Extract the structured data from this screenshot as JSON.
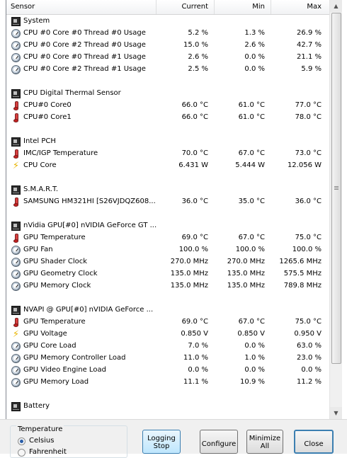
{
  "header": {
    "sensor": "Sensor",
    "current": "Current",
    "min": "Min",
    "max": "Max"
  },
  "rows": [
    {
      "type": "group",
      "icon": "board",
      "name": "System"
    },
    {
      "type": "item",
      "icon": "gauge",
      "name": "CPU #0 Core #0 Thread #0 Usage",
      "cur": "5.2 %",
      "min": "1.3 %",
      "max": "26.9 %"
    },
    {
      "type": "item",
      "icon": "gauge",
      "name": "CPU #0 Core #2 Thread #0 Usage",
      "cur": "15.0 %",
      "min": "2.6 %",
      "max": "42.7 %"
    },
    {
      "type": "item",
      "icon": "gauge",
      "name": "CPU #0 Core #0 Thread #1 Usage",
      "cur": "2.6 %",
      "min": "0.0 %",
      "max": "21.1 %"
    },
    {
      "type": "item",
      "icon": "gauge",
      "name": "CPU #0 Core #2 Thread #1 Usage",
      "cur": "2.5 %",
      "min": "0.0 %",
      "max": "5.9 %"
    },
    {
      "type": "blank"
    },
    {
      "type": "group",
      "icon": "board",
      "name": "CPU Digital Thermal Sensor"
    },
    {
      "type": "item",
      "icon": "therm",
      "name": "CPU#0 Core0",
      "cur": "66.0 °C",
      "min": "61.0 °C",
      "max": "77.0 °C"
    },
    {
      "type": "item",
      "icon": "therm",
      "name": "CPU#0 Core1",
      "cur": "66.0 °C",
      "min": "61.0 °C",
      "max": "78.0 °C"
    },
    {
      "type": "blank"
    },
    {
      "type": "group",
      "icon": "board",
      "name": "Intel PCH"
    },
    {
      "type": "item",
      "icon": "therm",
      "name": "IMC/IGP Temperature",
      "cur": "70.0 °C",
      "min": "67.0 °C",
      "max": "73.0 °C"
    },
    {
      "type": "item",
      "icon": "bolt",
      "name": "CPU Core",
      "cur": "6.431 W",
      "min": "5.444 W",
      "max": "12.056 W"
    },
    {
      "type": "blank"
    },
    {
      "type": "group",
      "icon": "board",
      "name": "S.M.A.R.T."
    },
    {
      "type": "item",
      "icon": "therm",
      "name": "SAMSUNG HM321HI [S26VJDQZ608...",
      "cur": "36.0 °C",
      "min": "35.0 °C",
      "max": "36.0 °C"
    },
    {
      "type": "blank"
    },
    {
      "type": "group",
      "icon": "board",
      "name": "nVidia GPU[#0] nVIDIA GeForce GT ..."
    },
    {
      "type": "item",
      "icon": "therm",
      "name": "GPU Temperature",
      "cur": "69.0 °C",
      "min": "67.0 °C",
      "max": "75.0 °C"
    },
    {
      "type": "item",
      "icon": "gauge",
      "name": "GPU Fan",
      "cur": "100.0 %",
      "min": "100.0 %",
      "max": "100.0 %"
    },
    {
      "type": "item",
      "icon": "gauge",
      "name": "GPU Shader Clock",
      "cur": "270.0 MHz",
      "min": "270.0 MHz",
      "max": "1265.6 MHz"
    },
    {
      "type": "item",
      "icon": "gauge",
      "name": "GPU Geometry Clock",
      "cur": "135.0 MHz",
      "min": "135.0 MHz",
      "max": "575.5 MHz"
    },
    {
      "type": "item",
      "icon": "gauge",
      "name": "GPU Memory Clock",
      "cur": "135.0 MHz",
      "min": "135.0 MHz",
      "max": "789.8 MHz"
    },
    {
      "type": "blank"
    },
    {
      "type": "group",
      "icon": "board",
      "name": "NVAPI @ GPU[#0] nVIDIA GeForce ..."
    },
    {
      "type": "item",
      "icon": "therm",
      "name": "GPU Temperature",
      "cur": "69.0 °C",
      "min": "67.0 °C",
      "max": "75.0 °C"
    },
    {
      "type": "item",
      "icon": "bolt",
      "name": "GPU Voltage",
      "cur": "0.850 V",
      "min": "0.850 V",
      "max": "0.950 V"
    },
    {
      "type": "item",
      "icon": "gauge",
      "name": "GPU Core Load",
      "cur": "7.0 %",
      "min": "0.0 %",
      "max": "63.0 %"
    },
    {
      "type": "item",
      "icon": "gauge",
      "name": "GPU Memory Controller Load",
      "cur": "11.0 %",
      "min": "1.0 %",
      "max": "23.0 %"
    },
    {
      "type": "item",
      "icon": "gauge",
      "name": "GPU Video Engine Load",
      "cur": "0.0 %",
      "min": "0.0 %",
      "max": "0.0 %"
    },
    {
      "type": "item",
      "icon": "gauge",
      "name": "GPU Memory Load",
      "cur": "11.1 %",
      "min": "10.9 %",
      "max": "11.2 %"
    },
    {
      "type": "blank"
    },
    {
      "type": "group",
      "icon": "board",
      "name": "Battery"
    }
  ],
  "temperature": {
    "legend": "Temperature",
    "celsius": "Celsius",
    "fahrenheit": "Fahrenheit",
    "selected": "Celsius"
  },
  "buttons": {
    "logging_line1": "Logging",
    "logging_line2": "Stop",
    "configure": "Configure",
    "minimize_line1": "Minimize",
    "minimize_line2": "All",
    "close": "Close"
  }
}
